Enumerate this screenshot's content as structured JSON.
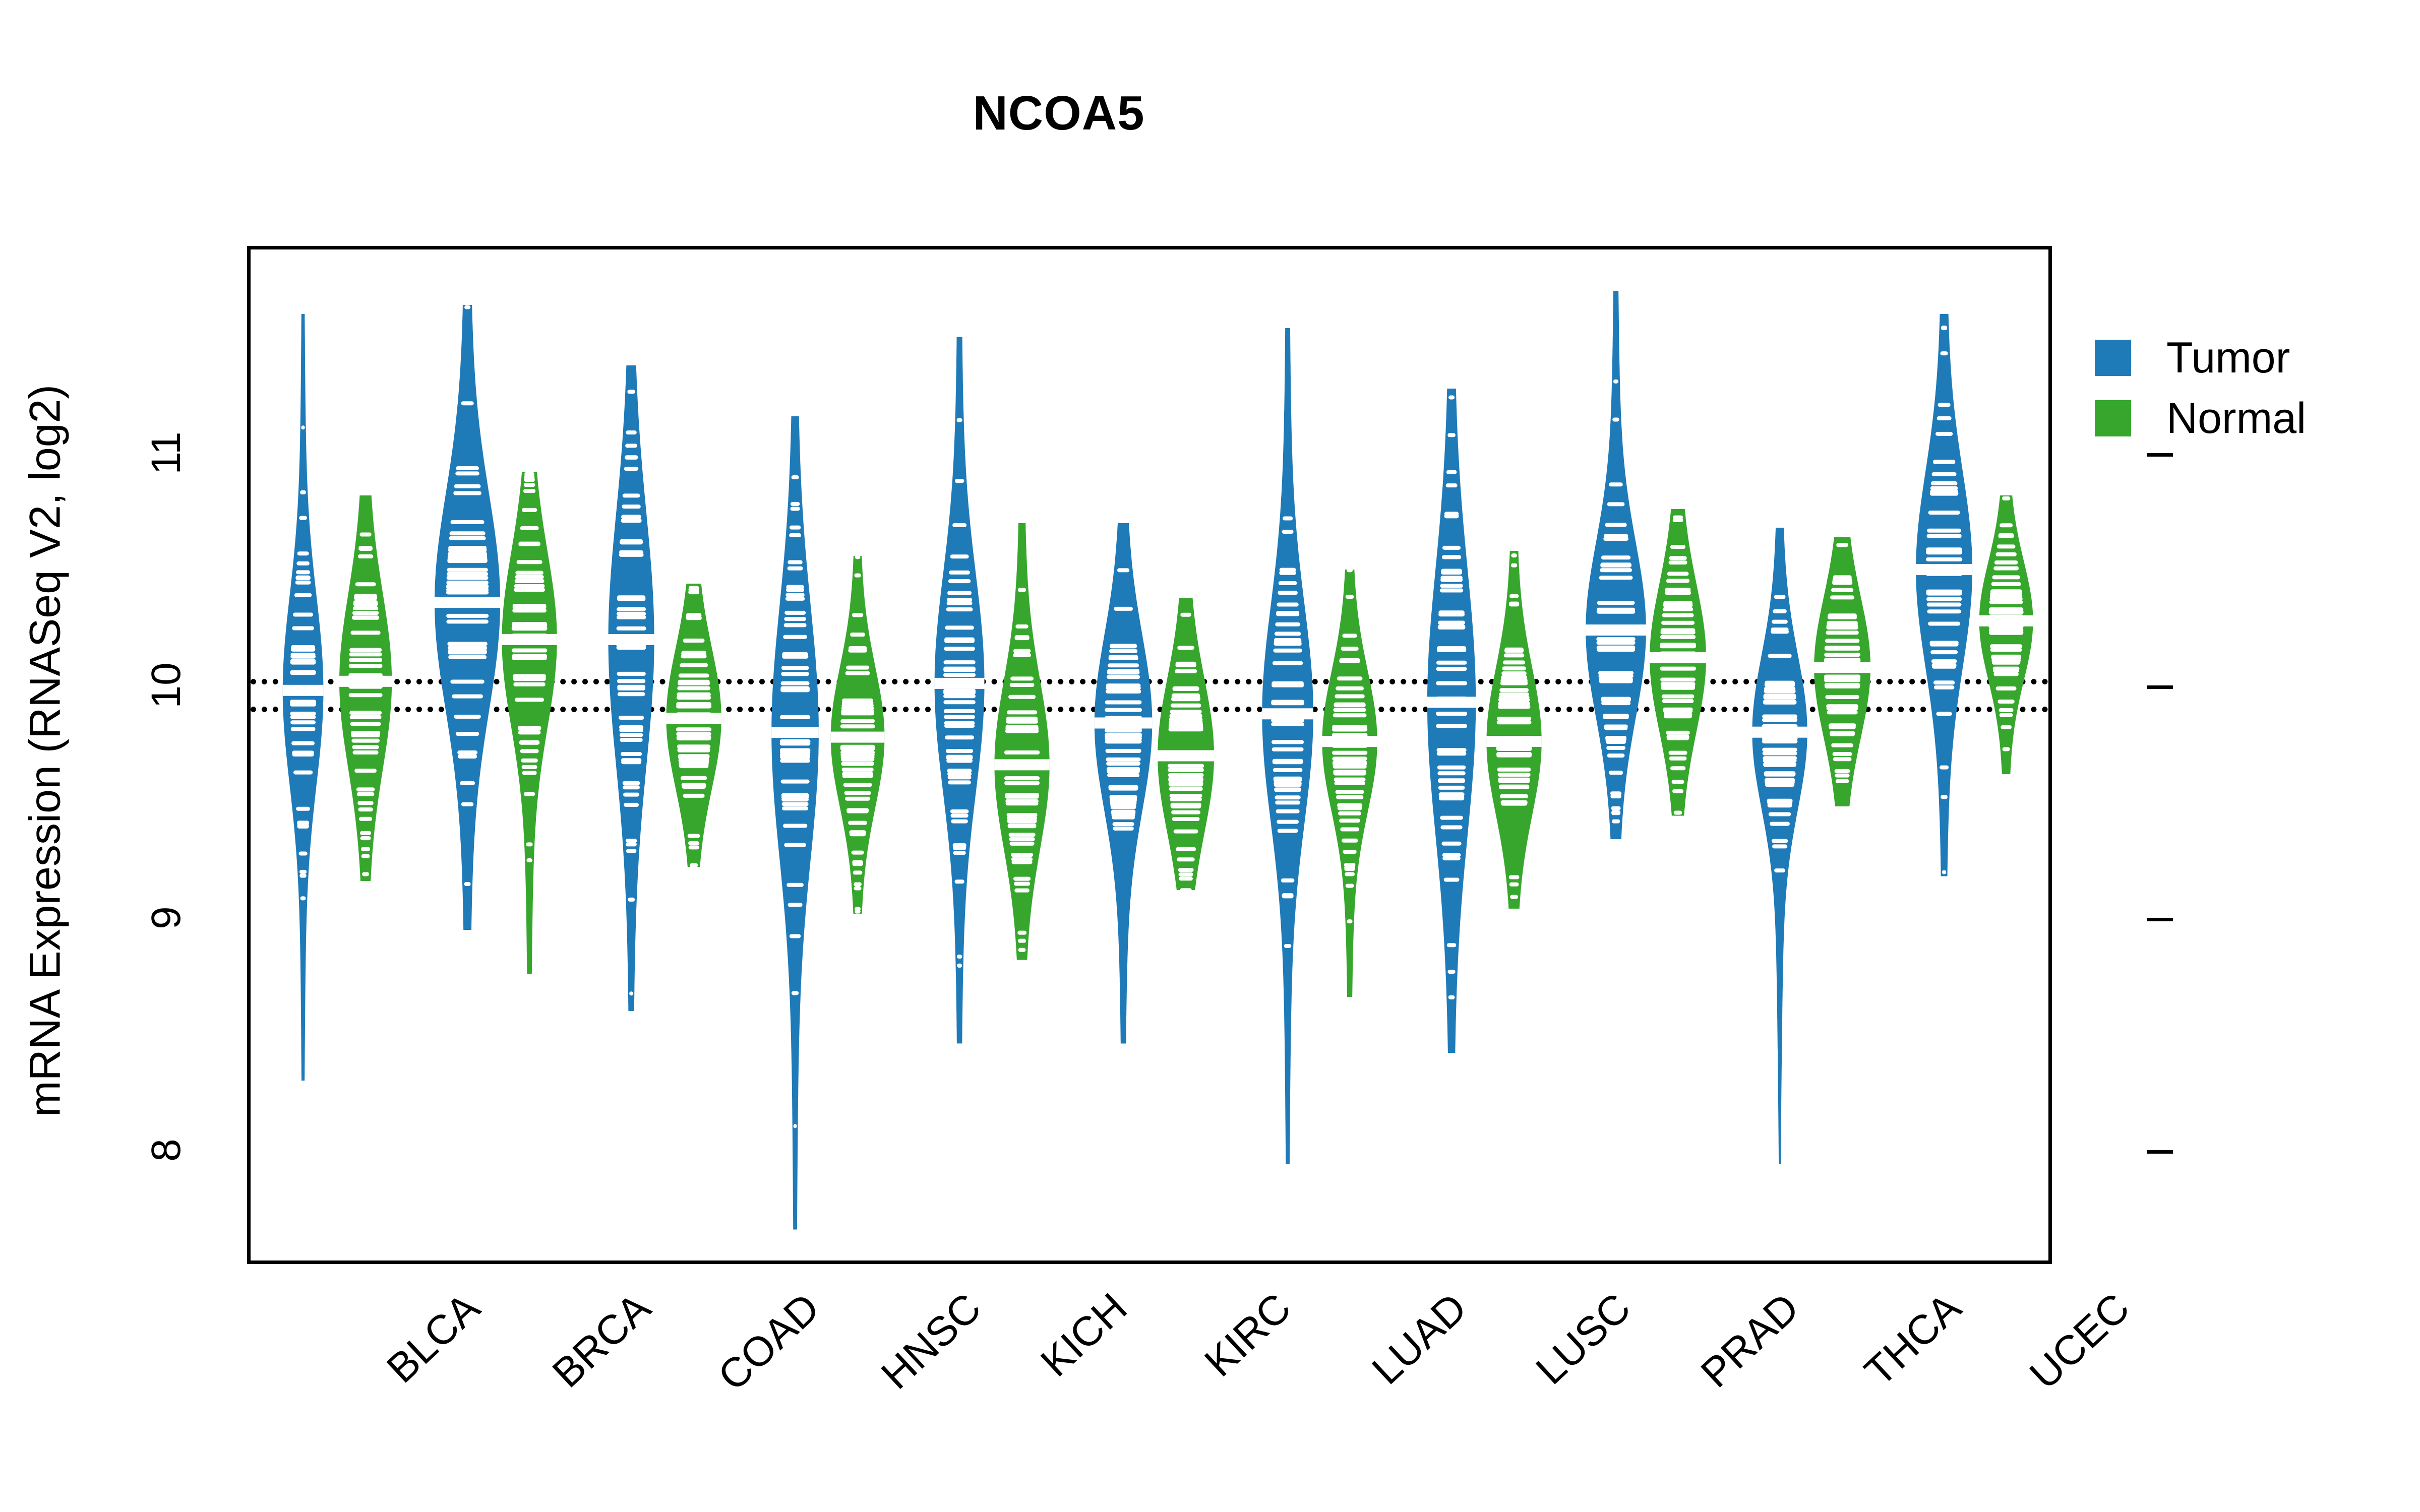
{
  "title": "NCOA5",
  "axes": {
    "ylabel": "mRNA Expression (RNASeq V2, log2)",
    "xlabel": "",
    "yticks": [
      "11",
      "10",
      "9",
      "8"
    ]
  },
  "legend": {
    "items": [
      {
        "label": "Tumor",
        "color": "#1f7ab8"
      },
      {
        "label": "Normal",
        "color": "#36a72c"
      }
    ]
  },
  "colors": {
    "tumor": "#1f7ab8",
    "normal": "#36a72c",
    "axis": "#000000",
    "reference_line": "#000000",
    "background": "#ffffff"
  },
  "chart_data": {
    "type": "violin",
    "title": "NCOA5",
    "xlabel": "",
    "ylabel": "mRNA Expression (RNASeq V2, log2)",
    "ylim": [
      7.5,
      11.9
    ],
    "ytick_values": [
      11,
      10,
      9,
      8
    ],
    "grid": false,
    "legend_position": "right",
    "reference_lines": [
      10.05,
      9.93
    ],
    "categories": [
      "BLCA",
      "BRCA",
      "COAD",
      "HNSC",
      "KICH",
      "KIRC",
      "LUAD",
      "LUSC",
      "PRAD",
      "THCA",
      "UCEC"
    ],
    "series": [
      {
        "name": "Tumor",
        "color": "#1f7ab8",
        "stats": [
          {
            "category": "BLCA",
            "median": 10.0,
            "q1": 9.78,
            "q3": 10.32,
            "min": 8.32,
            "max": 11.62,
            "width": 0.62
          },
          {
            "category": "BRCA",
            "median": 10.38,
            "q1": 10.08,
            "q3": 10.7,
            "min": 8.97,
            "max": 11.66,
            "width": 1.0
          },
          {
            "category": "COAD",
            "median": 10.22,
            "q1": 9.9,
            "q3": 10.62,
            "min": 8.62,
            "max": 11.4,
            "width": 0.7
          },
          {
            "category": "HNSC",
            "median": 9.82,
            "q1": 9.58,
            "q3": 10.3,
            "min": 7.68,
            "max": 11.18,
            "width": 0.72
          },
          {
            "category": "KICH",
            "median": 10.03,
            "q1": 9.7,
            "q3": 10.32,
            "min": 8.48,
            "max": 11.52,
            "width": 0.76
          },
          {
            "category": "KIRC",
            "median": 9.86,
            "q1": 9.66,
            "q3": 10.16,
            "min": 8.48,
            "max": 10.72,
            "width": 0.88
          },
          {
            "category": "LUAD",
            "median": 9.9,
            "q1": 9.6,
            "q3": 10.22,
            "min": 7.96,
            "max": 11.56,
            "width": 0.78
          },
          {
            "category": "LUSC",
            "median": 9.95,
            "q1": 9.62,
            "q3": 10.38,
            "min": 8.44,
            "max": 11.3,
            "width": 0.74
          },
          {
            "category": "PRAD",
            "median": 10.26,
            "q1": 10.02,
            "q3": 10.52,
            "min": 9.36,
            "max": 11.72,
            "width": 0.92
          },
          {
            "category": "THCA",
            "median": 9.82,
            "q1": 9.64,
            "q3": 10.08,
            "min": 7.96,
            "max": 10.7,
            "width": 0.84
          },
          {
            "category": "UCEC",
            "median": 10.52,
            "q1": 10.22,
            "q3": 10.78,
            "min": 9.2,
            "max": 11.62,
            "width": 0.86
          }
        ]
      },
      {
        "name": "Normal",
        "color": "#36a72c",
        "stats": [
          {
            "category": "BLCA",
            "median": 10.04,
            "q1": 9.82,
            "q3": 10.32,
            "min": 9.18,
            "max": 10.84,
            "width": 0.8
          },
          {
            "category": "BRCA",
            "median": 10.22,
            "q1": 10.0,
            "q3": 10.5,
            "min": 8.78,
            "max": 10.94,
            "width": 0.84
          },
          {
            "category": "COAD",
            "median": 9.88,
            "q1": 9.72,
            "q3": 10.12,
            "min": 9.24,
            "max": 10.46,
            "width": 0.84
          },
          {
            "category": "HNSC",
            "median": 9.8,
            "q1": 9.62,
            "q3": 10.02,
            "min": 9.04,
            "max": 10.58,
            "width": 0.82
          },
          {
            "category": "KICH",
            "median": 9.68,
            "q1": 9.48,
            "q3": 9.96,
            "min": 8.84,
            "max": 10.72,
            "width": 0.84
          },
          {
            "category": "KIRC",
            "median": 9.72,
            "q1": 9.54,
            "q3": 9.98,
            "min": 9.14,
            "max": 10.4,
            "width": 0.86
          },
          {
            "category": "LUAD",
            "median": 9.78,
            "q1": 9.6,
            "q3": 10.0,
            "min": 8.68,
            "max": 10.52,
            "width": 0.84
          },
          {
            "category": "LUSC",
            "median": 9.78,
            "q1": 9.6,
            "q3": 10.02,
            "min": 9.06,
            "max": 10.6,
            "width": 0.84
          },
          {
            "category": "PRAD",
            "median": 10.14,
            "q1": 9.96,
            "q3": 10.38,
            "min": 9.46,
            "max": 10.78,
            "width": 0.86
          },
          {
            "category": "THCA",
            "median": 10.1,
            "q1": 9.92,
            "q3": 10.32,
            "min": 9.5,
            "max": 10.66,
            "width": 0.86
          },
          {
            "category": "UCEC",
            "median": 10.3,
            "q1": 10.16,
            "q3": 10.5,
            "min": 9.64,
            "max": 10.84,
            "width": 0.82
          }
        ]
      }
    ]
  }
}
